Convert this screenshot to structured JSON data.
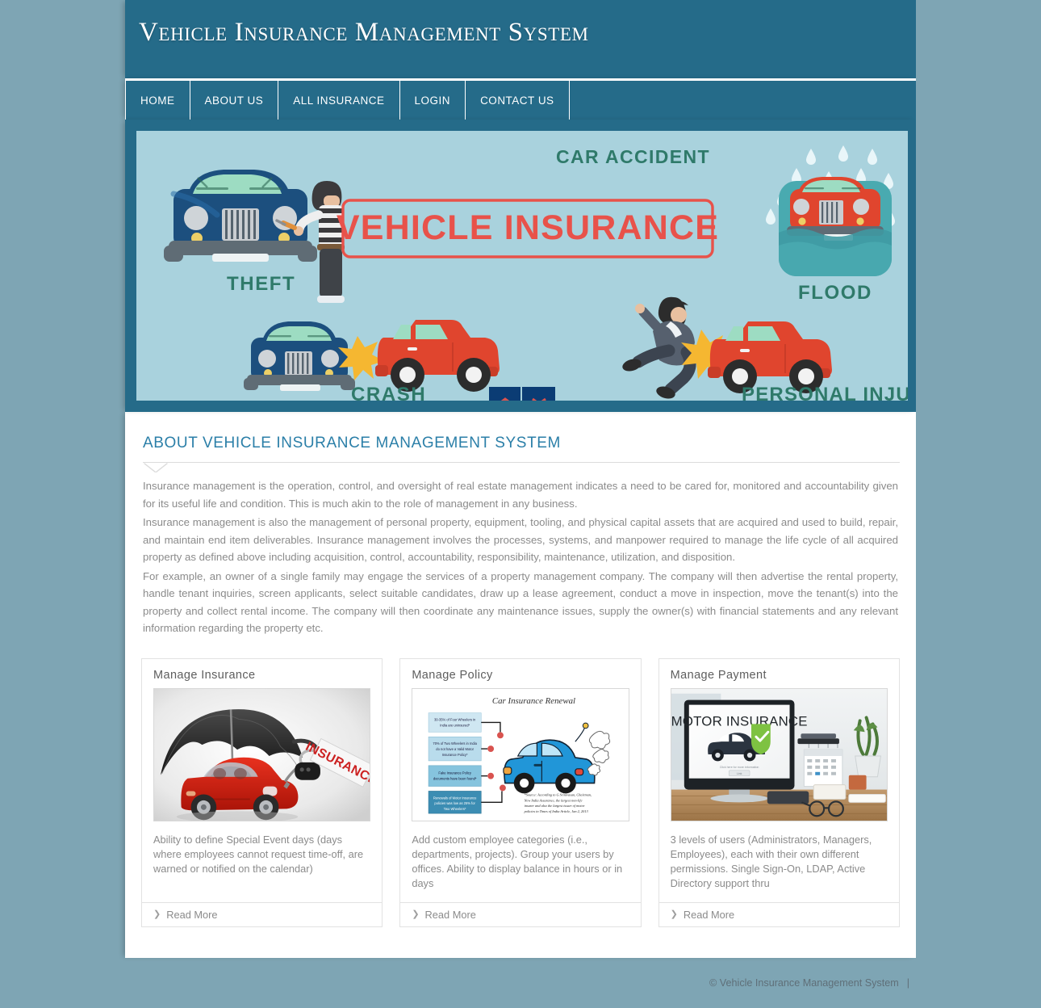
{
  "site": {
    "title": "Vehicle Insurance Management System",
    "accent_color": "#256b89",
    "page_background": "#7ea5b4",
    "heading_color": "#2b7fa8"
  },
  "nav": {
    "items": [
      {
        "label": "HOME"
      },
      {
        "label": "ABOUT US"
      },
      {
        "label": "ALL INSURANCE"
      },
      {
        "label": "LOGIN"
      },
      {
        "label": "CONTACT US"
      }
    ]
  },
  "banner": {
    "headline": "VEHICLE INSURANCE",
    "labels": {
      "theft": "THEFT",
      "crash": "CRASH",
      "car_accident": "CAR ACCIDENT",
      "flood": "FLOOD",
      "personal_injury": "PERSONAL INJURY"
    },
    "background_color": "#a9d2dd",
    "headline_color": "#e8524a",
    "label_color": "#2f7a6a",
    "controls": {
      "prev": "prev-slide",
      "next": "next-slide"
    }
  },
  "about": {
    "heading": "ABOUT VEHICLE INSURANCE MANAGEMENT SYSTEM",
    "paragraphs": [
      "Insurance management is the operation, control, and oversight of real estate management indicates a need to be cared for, monitored and accountability given for its useful life and condition. This is much akin to the role of management in any business.",
      "Insurance management is also the management of personal property, equipment, tooling, and physical capital assets that are acquired and used to build, repair, and maintain end item deliverables. Insurance management involves the processes, systems, and manpower required to manage the life cycle of all acquired property as defined above including acquisition, control, accountability, responsibility, maintenance, utilization, and disposition.",
      "For example, an owner of a single family may engage the services of a property management company. The company will then advertise the rental property, handle tenant inquiries, screen applicants, select suitable candidates, draw up a lease agreement, conduct a move in inspection, move the tenant(s) into the property and collect rental income. The company will then coordinate any maintenance issues, supply the owner(s) with financial statements and any relevant information regarding the property etc."
    ]
  },
  "cards": [
    {
      "title": "Manage Insurance",
      "image_alt": "black-umbrella-over-red-car-with-insurance-keychain",
      "text": "Ability to define Special Event days (days where employees cannot request time-off, are warned or notified on the calendar)",
      "read_more": "Read More"
    },
    {
      "title": "Manage Policy",
      "image_alt": "car-insurance-renewal-infographic",
      "infographic": {
        "title": "Car Insurance Renewal",
        "boxes": [
          "30-35% of Four Wheelers in India are uninsured*",
          "70% of Two Wheelers in India do not have a Valid Motor Insurance Policy*",
          "Fake Insurance Policy documents have been found*",
          "Renewals of Motor Insurance policies was low as 25% for Two Wheelers*"
        ],
        "source": "*Source: According to G Srinivasan, Chairman, New India Assurance, the largest non-life insurer and also the largest issuer of motor policies in Times of India Article, Jan 2, 2013"
      },
      "text": "Add custom employee categories (i.e., departments, projects). Group your users by offices. Ability to display balance in hours or in days",
      "read_more": "Read More"
    },
    {
      "title": "Manage Payment",
      "image_alt": "desktop-monitor-showing-motor-insurance-page-on-desk",
      "monitor_text": "MOTOR INSURANCE",
      "text": "3 levels of users (Administrators, Managers, Employees), each with their own different permissions. Single Sign-On, LDAP, Active Directory support thru",
      "read_more": "Read More"
    }
  ],
  "footer": {
    "copyright": "© Vehicle Insurance Management System",
    "separator": "|"
  }
}
